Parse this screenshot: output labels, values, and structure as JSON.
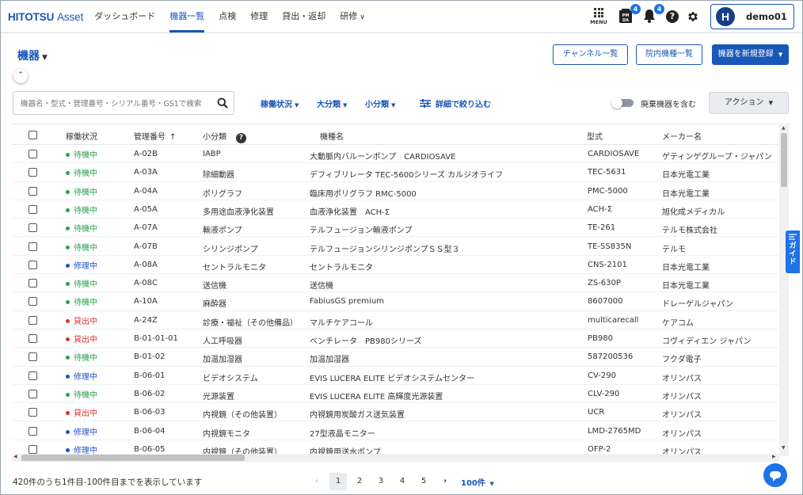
{
  "app": {
    "logo_brand": "HITOTSU",
    "logo_product": "Asset"
  },
  "nav": {
    "items": [
      {
        "label": "ダッシュボード",
        "active": false
      },
      {
        "label": "機器一覧",
        "active": true
      },
      {
        "label": "点検",
        "active": false
      },
      {
        "label": "修理",
        "active": false
      },
      {
        "label": "貸出・返却",
        "active": false
      },
      {
        "label": "研修",
        "active": false,
        "dropdown": true
      }
    ],
    "menu_label": "MENU",
    "pmda_badge": "4",
    "bell_badge": "4",
    "pmda_icon_text": "PM DA",
    "user_initial": "H",
    "username": "demo01"
  },
  "header": {
    "title": "機器",
    "channel_list_button": "チャンネル一覧",
    "inhouse_list_button": "院内機種一覧",
    "new_register_button": "機器を新規登録"
  },
  "filters": {
    "search_placeholder": "機器名・型式・管理番号・シリアル番号・GS1で検索",
    "status": "稼働状況",
    "major_category": "大分類",
    "minor_category": "小分類",
    "detail": "詳細で絞り込む",
    "include_disposed": "廃棄機器を含む",
    "action": "アクション"
  },
  "table": {
    "columns": {
      "status": "稼働状況",
      "management_no": "管理番号",
      "sort_indicator": "↑",
      "subcategory": "小分類",
      "model_name": "機種名",
      "model_type": "型式",
      "maker": "メーカー名"
    },
    "status_colors": {
      "待機中": "#2e9e4f",
      "修理中": "#1e50c8",
      "貸出中": "#d9342b"
    },
    "rows": [
      {
        "status": "待機中",
        "no": "A-02B",
        "sub": "IABP",
        "name": "大動脈内バルーンポンプ　CARDIOSAVE",
        "type": "CARDIOSAVE",
        "maker": "ゲティンゲグループ・ジャパン"
      },
      {
        "status": "待機中",
        "no": "A-03A",
        "sub": "除細動器",
        "name": "デフィブリレータ TEC-5600シリーズ カルジオライフ",
        "type": "TEC-5631",
        "maker": "日本光電工業"
      },
      {
        "status": "待機中",
        "no": "A-04A",
        "sub": "ポリグラフ",
        "name": "臨床用ポリグラフ RMC-5000",
        "type": "PMC-5000",
        "maker": "日本光電工業"
      },
      {
        "status": "待機中",
        "no": "A-05A",
        "sub": "多用途血液浄化装置",
        "name": "血液浄化装置　ACH-Σ",
        "type": "ACH-Σ",
        "maker": "旭化成メディカル"
      },
      {
        "status": "待機中",
        "no": "A-07A",
        "sub": "輸液ポンプ",
        "name": "テルフュージョン輸液ポンプ",
        "type": "TE-261",
        "maker": "テルモ株式会社"
      },
      {
        "status": "待機中",
        "no": "A-07B",
        "sub": "シリンジポンプ",
        "name": "テルフュージョンシリンジポンプＳＳ型３",
        "type": "TE-SS835N",
        "maker": "テルモ"
      },
      {
        "status": "修理中",
        "no": "A-08A",
        "sub": "セントラルモニタ",
        "name": "セントラルモニタ",
        "type": "CNS-2101",
        "maker": "日本光電工業"
      },
      {
        "status": "待機中",
        "no": "A-08C",
        "sub": "送信機",
        "name": "送信機",
        "type": "ZS-630P",
        "maker": "日本光電工業"
      },
      {
        "status": "待機中",
        "no": "A-10A",
        "sub": "麻酔器",
        "name": "FabiusGS premium",
        "type": "8607000",
        "maker": "ドレーゲルジャパン"
      },
      {
        "status": "貸出中",
        "no": "A-24Z",
        "sub": "診療・福祉（その他備品）",
        "name": "マルチケアコール",
        "type": "multicarecall",
        "maker": "ケアコム"
      },
      {
        "status": "貸出中",
        "no": "B-01-01-01",
        "sub": "人工呼吸器",
        "name": "ベンチレータ　PB980シリーズ",
        "type": "PB980",
        "maker": "コヴィディエン ジャパン"
      },
      {
        "status": "待機中",
        "no": "B-01-02",
        "sub": "加温加湿器",
        "name": "加温加湿器",
        "type": "587200536",
        "maker": "フクダ電子"
      },
      {
        "status": "修理中",
        "no": "B-06-01",
        "sub": "ビデオシステム",
        "name": "EVIS LUCERA ELITE ビデオシステムセンター",
        "type": "CV-290",
        "maker": "オリンパス"
      },
      {
        "status": "待機中",
        "no": "B-06-02",
        "sub": "光源装置",
        "name": "EVIS LUCERA ELITE 高輝度光源装置",
        "type": "CLV-290",
        "maker": "オリンパス"
      },
      {
        "status": "貸出中",
        "no": "B-06-03",
        "sub": "内視鏡（その他装置）",
        "name": "内視鏡用炭酸ガス送気装置",
        "type": "UCR",
        "maker": "オリンパス"
      },
      {
        "status": "修理中",
        "no": "B-06-04",
        "sub": "内視鏡モニタ",
        "name": "27型液晶モニター",
        "type": "LMD-2765MD",
        "maker": "オリンパス"
      },
      {
        "status": "修理中",
        "no": "B-06-05",
        "sub": "内視鏡（その他装置）",
        "name": "内視鏡用送水ポンプ",
        "type": "OFP-2",
        "maker": "オリンパス"
      }
    ]
  },
  "guide_tab": "ガイド",
  "footer": {
    "count_text": "420件のうち1件目-100件目までを表示しています",
    "pages": [
      "1",
      "2",
      "3",
      "4",
      "5"
    ],
    "current_page": "1",
    "per_page": "100件"
  },
  "colors": {
    "brand": "#1957b8",
    "accent": "#1e73e8"
  }
}
